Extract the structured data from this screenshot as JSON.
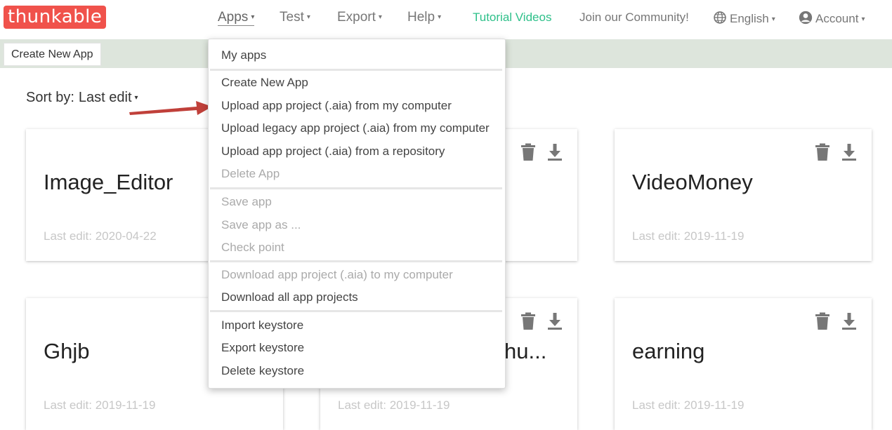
{
  "brand": {
    "logo_text": "thunkable",
    "color": "#f0524b"
  },
  "nav": {
    "apps": "Apps",
    "test": "Test",
    "export": "Export",
    "help": "Help",
    "tutorial": "Tutorial Videos",
    "community": "Join our Community!",
    "language": "English",
    "account": "Account",
    "caret": "▾"
  },
  "toolbar": {
    "create_new_app": "Create New App"
  },
  "sort": {
    "label": "Sort by:",
    "value": "Last edit",
    "caret": "▾"
  },
  "cards": [
    {
      "title": "Image_Editor",
      "date": "Last edit: 2020-04-22"
    },
    {
      "title": "",
      "date": ""
    },
    {
      "title": "VideoMoney",
      "date": "Last edit: 2019-11-19"
    },
    {
      "title": "Ghjb",
      "date": "Last edit: 2019-11-19"
    },
    {
      "title": "hu...",
      "date": "Last edit: 2019-11-19"
    },
    {
      "title": "earning",
      "date": "Last edit: 2019-11-19"
    }
  ],
  "menu": {
    "my_apps": "My apps",
    "create_new_app": "Create New App",
    "upload_aia_computer": "Upload app project (.aia) from my computer",
    "upload_legacy": "Upload legacy app project (.aia) from my computer",
    "upload_repo": "Upload app project (.aia) from a repository",
    "delete_app": "Delete App",
    "save_app": "Save app",
    "save_app_as": "Save app as ...",
    "check_point": "Check point",
    "download_aia": "Download app project (.aia) to my computer",
    "download_all": "Download all app projects",
    "import_keystore": "Import keystore",
    "export_keystore": "Export keystore",
    "delete_keystore": "Delete keystore"
  },
  "colors": {
    "strip": "#dde5dc",
    "accent_green": "#2ec08a",
    "arrow": "#c0403a",
    "icon_grey": "#777777"
  },
  "icons": [
    "globe-icon",
    "account-icon",
    "trash-icon",
    "download-icon",
    "arrow-annotation"
  ]
}
